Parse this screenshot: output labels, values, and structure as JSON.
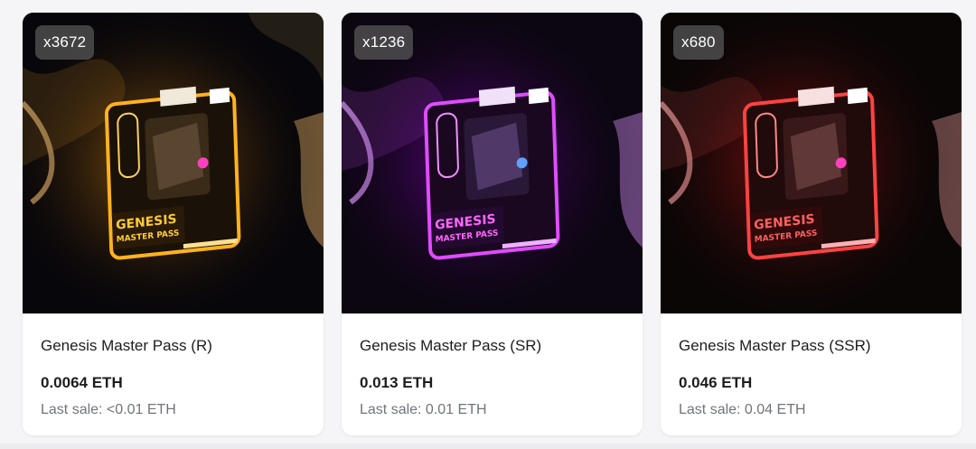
{
  "cards": [
    {
      "quantity": "x3672",
      "title": "Genesis Master Pass (R)",
      "price": "0.0064 ETH",
      "last_sale": "Last sale: <0.01 ETH",
      "accent": "#ffb21e",
      "glow": "#ff8a00",
      "image_text_top": "GENESIS",
      "image_text_bottom": "MASTER PASS"
    },
    {
      "quantity": "x1236",
      "title": "Genesis Master Pass (SR)",
      "price": "0.013 ETH",
      "last_sale": "Last sale: 0.01 ETH",
      "accent": "#e04cff",
      "glow": "#b300ff",
      "image_text_top": "GENESIS",
      "image_text_bottom": "MASTER PASS"
    },
    {
      "quantity": "x680",
      "title": "Genesis Master Pass (SSR)",
      "price": "0.046 ETH",
      "last_sale": "Last sale: 0.04 ETH",
      "accent": "#ff4242",
      "glow": "#ff1a1a",
      "image_text_top": "GENESIS",
      "image_text_bottom": "MASTER PASS"
    }
  ]
}
